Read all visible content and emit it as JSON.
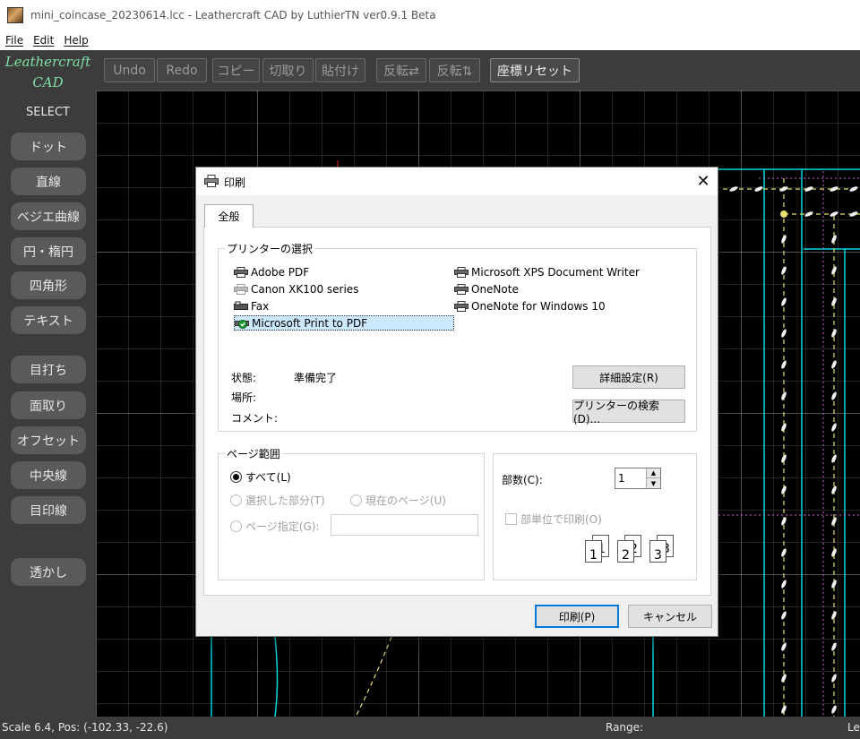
{
  "window": {
    "title": "mini_coincase_20230614.lcc - Leathercraft CAD by LuthierTN ver0.9.1 Beta"
  },
  "menu": {
    "items": [
      "File",
      "Edit",
      "Help"
    ]
  },
  "sidebar": {
    "logo_line1": "Leathercraft",
    "logo_line2": "CAD",
    "mode_label": "SELECT",
    "tools": [
      "ドット",
      "直線",
      "ベジエ曲線",
      "円・楕円",
      "四角形",
      "テキスト",
      "目打ち",
      "面取り",
      "オフセット",
      "中央線",
      "目印線",
      "透かし"
    ]
  },
  "toolbar": {
    "undo": "Undo",
    "redo": "Redo",
    "copy": "コピー",
    "cut": "切取り",
    "paste": "貼付け",
    "flip_h": "反転⇄",
    "flip_v": "反転⇅",
    "reset_coords": "座標リセット"
  },
  "status": {
    "position": "Scale 6.4, Pos: (-102.33, -22.6)",
    "range": "Range:",
    "layer": "Le"
  },
  "colors": {
    "canvas_bg": "#000000",
    "cyan_line": "#00d8e0",
    "yellow_dashed": "#e8e070",
    "magenta_dotted": "#d060d0",
    "red_mark": "#ff2020"
  },
  "dialog": {
    "title": "印刷",
    "tab_general": "全般",
    "printer_group": "プリンターの選択",
    "printers_left": [
      {
        "name": "Adobe PDF",
        "icon": "printer-icon"
      },
      {
        "name": "Canon XK100 series",
        "icon": "printer-icon"
      },
      {
        "name": "Fax",
        "icon": "fax-icon"
      },
      {
        "name": "Microsoft Print to PDF",
        "icon": "printer-default-icon",
        "selected": true
      }
    ],
    "printers_right": [
      {
        "name": "Microsoft XPS Document Writer",
        "icon": "printer-icon"
      },
      {
        "name": "OneNote",
        "icon": "printer-icon"
      },
      {
        "name": "OneNote for Windows 10",
        "icon": "printer-icon"
      }
    ],
    "status_label": "状態:",
    "status_value": "準備完了",
    "location_label": "場所:",
    "comment_label": "コメント:",
    "preferences_button": "詳細設定(R)",
    "find_printer_button": "プリンターの検索(D)...",
    "page_range_group": "ページ範囲",
    "range_all": "すべて(L)",
    "range_selection": "選択した部分(T)",
    "range_current": "現在のページ(U)",
    "range_pages": "ページ指定(G):",
    "copies_label": "部数(C):",
    "copies_value": "1",
    "collate_label": "部単位で印刷(O)",
    "collate_pages": [
      "1",
      "1",
      "2",
      "2",
      "3",
      "3"
    ],
    "print_button": "印刷(P)",
    "cancel_button": "キャンセル"
  }
}
